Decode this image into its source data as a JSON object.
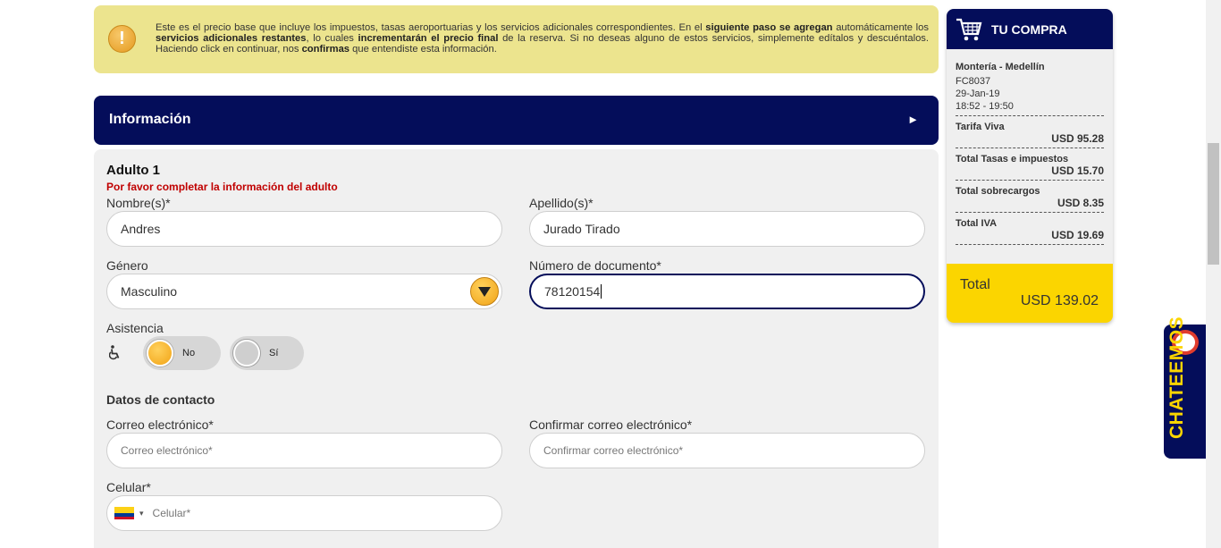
{
  "notice": {
    "part1": "Este es el precio base que incluye los impuestos, tasas aeroportuarias y los servicios adicionales correspondientes. En el ",
    "bold1": "siguiente paso se agregan",
    "part2": " automáticamente los ",
    "bold2": "servicios adicionales restantes",
    "part3": ", lo cuales ",
    "bold3": "incrementarán el precio final",
    "part4": " de la reserva. Si no deseas alguno de estos servicios, simplemente edítalos y descuéntalos. Haciendo click en continuar, nos ",
    "bold4": "confirmas",
    "part5": " que entendiste esta información.",
    "icon": "warning-icon"
  },
  "info": {
    "title": "Información",
    "arrow": "►"
  },
  "form": {
    "section_title": "Adulto 1",
    "error": "Por favor completar la información del adulto",
    "first_name": {
      "label": "Nombre(s)*",
      "value": "Andres"
    },
    "last_name": {
      "label": "Apellido(s)*",
      "value": "Jurado Tirado"
    },
    "gender": {
      "label": "Género",
      "value": "Masculino"
    },
    "document": {
      "label": "Número de documento*",
      "value": "78120154"
    },
    "assistance": {
      "label": "Asistencia",
      "icon": "wheelchair-icon",
      "no": "No",
      "yes": "Sí",
      "selected": "No"
    },
    "contact_title": "Datos de contacto",
    "email": {
      "label": "Correo electrónico*",
      "placeholder": "Correo electrónico*"
    },
    "email_confirm": {
      "label": "Confirmar correo electrónico*",
      "placeholder": "Confirmar correo electrónico*"
    },
    "phone": {
      "label": "Celular*",
      "placeholder": "Celular*",
      "flag": "colombia-flag-icon",
      "caret": "▾"
    }
  },
  "cart": {
    "title": "TU COMPRA",
    "icon": "shopping-cart-icon",
    "route": "Montería - Medellín",
    "flight": "FC8037",
    "date": "29-Jan-19",
    "time": "18:52 - 19:50",
    "rows": [
      {
        "name": "Tarifa Viva",
        "value": "USD 95.28"
      },
      {
        "name": "Total Tasas e impuestos",
        "value": "USD 15.70"
      },
      {
        "name": "Total sobrecargos",
        "value": "USD 8.35"
      },
      {
        "name": "Total IVA",
        "value": "USD 19.69"
      }
    ],
    "total_label": "Total",
    "total_value": "USD 139.02"
  },
  "chat": {
    "label": "CHATEEMOS",
    "icon": "chat-bubble-icon"
  },
  "colors": {
    "navy": "#040d5a",
    "yellow": "#fbd500",
    "notice_bg": "#ece48e",
    "error": "#c00000"
  }
}
